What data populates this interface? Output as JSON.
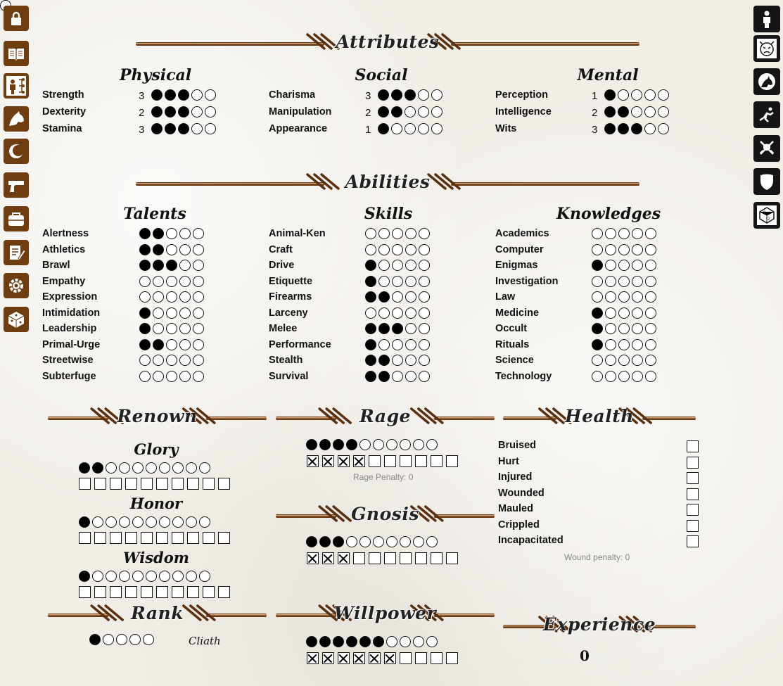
{
  "left_nav": [
    {
      "icon": "lock-icon"
    },
    {
      "icon": "book-icon"
    },
    {
      "icon": "character-tree-icon"
    },
    {
      "icon": "wolf-head-icon"
    },
    {
      "icon": "moon-icon"
    },
    {
      "icon": "pistol-icon"
    },
    {
      "icon": "bag-icon"
    },
    {
      "icon": "notes-icon"
    },
    {
      "icon": "gear-icon"
    },
    {
      "icon": "dice-icon"
    }
  ],
  "right_nav": [
    {
      "icon": "person-icon"
    },
    {
      "icon": "angry-face-icon"
    },
    {
      "icon": "wolf-silhouette-icon"
    },
    {
      "icon": "leaping-figure-icon"
    },
    {
      "icon": "crossed-swords-icon"
    },
    {
      "icon": "shield-icon"
    },
    {
      "icon": "d20-icon"
    }
  ],
  "attributes": {
    "title": "Attributes",
    "columns": [
      {
        "heading": "Physical",
        "rows": [
          {
            "label": "Strength",
            "value": "3",
            "dots": 3
          },
          {
            "label": "Dexterity",
            "value": "2",
            "dots": 3
          },
          {
            "label": "Stamina",
            "value": "3",
            "dots": 3
          }
        ]
      },
      {
        "heading": "Social",
        "rows": [
          {
            "label": "Charisma",
            "value": "3",
            "dots": 3
          },
          {
            "label": "Manipulation",
            "value": "2",
            "dots": 2
          },
          {
            "label": "Appearance",
            "value": "1",
            "dots": 1
          }
        ]
      },
      {
        "heading": "Mental",
        "rows": [
          {
            "label": "Perception",
            "value": "1",
            "dots": 1
          },
          {
            "label": "Intelligence",
            "value": "2",
            "dots": 2
          },
          {
            "label": "Wits",
            "value": "3",
            "dots": 3
          }
        ]
      }
    ]
  },
  "abilities": {
    "title": "Abilities",
    "columns": [
      {
        "heading": "Talents",
        "rows": [
          {
            "label": "Alertness",
            "dots": 2
          },
          {
            "label": "Athletics",
            "dots": 2
          },
          {
            "label": "Brawl",
            "dots": 3
          },
          {
            "label": "Empathy",
            "dots": 0
          },
          {
            "label": "Expression",
            "dots": 0
          },
          {
            "label": "Intimidation",
            "dots": 1
          },
          {
            "label": "Leadership",
            "dots": 1
          },
          {
            "label": "Primal-Urge",
            "dots": 2
          },
          {
            "label": "Streetwise",
            "dots": 0
          },
          {
            "label": "Subterfuge",
            "dots": 0
          }
        ]
      },
      {
        "heading": "Skills",
        "rows": [
          {
            "label": "Animal-Ken",
            "dots": 0
          },
          {
            "label": "Craft",
            "dots": 0
          },
          {
            "label": "Drive",
            "dots": 1
          },
          {
            "label": "Etiquette",
            "dots": 1
          },
          {
            "label": "Firearms",
            "dots": 2
          },
          {
            "label": "Larceny",
            "dots": 0
          },
          {
            "label": "Melee",
            "dots": 3
          },
          {
            "label": "Performance",
            "dots": 1
          },
          {
            "label": "Stealth",
            "dots": 2
          },
          {
            "label": "Survival",
            "dots": 2
          }
        ]
      },
      {
        "heading": "Knowledges",
        "rows": [
          {
            "label": "Academics",
            "dots": 0
          },
          {
            "label": "Computer",
            "dots": 0
          },
          {
            "label": "Enigmas",
            "dots": 1
          },
          {
            "label": "Investigation",
            "dots": 0
          },
          {
            "label": "Law",
            "dots": 0
          },
          {
            "label": "Medicine",
            "dots": 1
          },
          {
            "label": "Occult",
            "dots": 1
          },
          {
            "label": "Rituals",
            "dots": 1
          },
          {
            "label": "Science",
            "dots": 0
          },
          {
            "label": "Technology",
            "dots": 0
          }
        ]
      }
    ]
  },
  "renown": {
    "title": "Renown",
    "tracks": [
      {
        "heading": "Glory",
        "dots": 2,
        "boxes": 0
      },
      {
        "heading": "Honor",
        "dots": 1,
        "boxes": 0
      },
      {
        "heading": "Wisdom",
        "dots": 1,
        "boxes": 0
      }
    ]
  },
  "rage": {
    "title": "Rage",
    "dots": 4,
    "boxes_crossed": 4,
    "penalty_text": "Rage Penalty: 0"
  },
  "gnosis": {
    "title": "Gnosis",
    "dots": 3,
    "boxes_crossed": 3
  },
  "willpower": {
    "title": "Willpower",
    "dots": 6,
    "boxes_crossed": 6
  },
  "health": {
    "title": "Health",
    "levels": [
      {
        "label": "Bruised",
        "checked": false
      },
      {
        "label": "Hurt",
        "checked": false
      },
      {
        "label": "Injured",
        "checked": false
      },
      {
        "label": "Wounded",
        "checked": false
      },
      {
        "label": "Mauled",
        "checked": false
      },
      {
        "label": "Crippled",
        "checked": false
      },
      {
        "label": "Incapacitated",
        "checked": false
      }
    ],
    "penalty_text": "Wound penalty: 0"
  },
  "rank": {
    "title": "Rank",
    "dots": 1,
    "name": "Cliath"
  },
  "experience": {
    "title": "Experience",
    "value": "0"
  }
}
